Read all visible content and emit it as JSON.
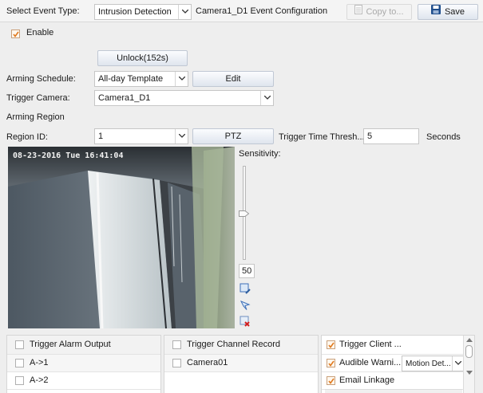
{
  "header": {
    "select_event_label": "Select Event Type:",
    "event_type_value": "Intrusion Detection",
    "config_title": "Camera1_D1 Event Configuration",
    "copy_label": "Copy to...",
    "save_label": "Save"
  },
  "enable_label": "Enable",
  "unlock_label": "Unlock(152s)",
  "arming_schedule": {
    "label": "Arming Schedule:",
    "value": "All-day Template",
    "edit_label": "Edit"
  },
  "trigger_camera": {
    "label": "Trigger Camera:",
    "value": "Camera1_D1"
  },
  "arming_region_label": "Arming Region",
  "region": {
    "label": "Region ID:",
    "value": "1",
    "ptz_label": "PTZ"
  },
  "threshold": {
    "label": "Trigger Time Thresh...",
    "value": "5",
    "unit": "Seconds"
  },
  "video": {
    "timestamp": "08-23-2016 Tue 16:41:04"
  },
  "sensitivity": {
    "label": "Sensitivity:",
    "value": "50",
    "level": 0.5
  },
  "linkage": {
    "alarm_output": {
      "header": "Trigger Alarm Output",
      "items": [
        "A->1",
        "A->2"
      ]
    },
    "channel_record": {
      "header": "Trigger Channel Record",
      "items": [
        "Camera01"
      ]
    },
    "client": {
      "header": "Trigger Client ...",
      "audible_label": "Audible Warni...",
      "audible_value": "Motion Det...",
      "email_label": "Email Linkage"
    }
  },
  "colors": {
    "check_orange": "#e07a1f",
    "save_blue": "#1f4e8c",
    "icon_blue": "#3d6fb8",
    "delete_red": "#d42020"
  }
}
